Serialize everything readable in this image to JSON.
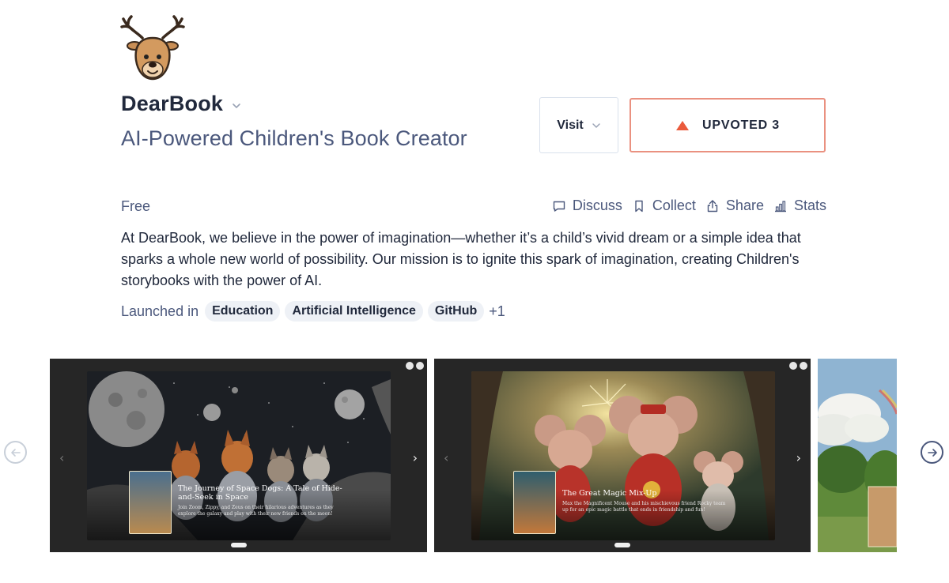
{
  "product": {
    "name": "DearBook",
    "tagline": "AI-Powered Children's Book Creator",
    "pricing": "Free",
    "description": "At DearBook, we believe in the power of imagination—whether it’s a child’s vivid dream or a simple idea that sparks a whole new world of possibility. Our mission is to ignite this spark of imagination, creating Children's storybooks with the power of AI."
  },
  "buttons": {
    "visit_label": "Visit",
    "upvote_label": "UPVOTED 3"
  },
  "actions": [
    {
      "label": "Discuss",
      "icon": "comment-icon"
    },
    {
      "label": "Collect",
      "icon": "bookmark-icon"
    },
    {
      "label": "Share",
      "icon": "share-icon"
    },
    {
      "label": "Stats",
      "icon": "bar-chart-icon"
    }
  ],
  "launched": {
    "label": "Launched in",
    "tags": [
      "Education",
      "Artificial Intelligence",
      "GitHub"
    ],
    "more": "+1"
  },
  "gallery": {
    "slides": [
      {
        "title": "The Journey of Space Dogs: A Tale of Hide-and-Seek in Space",
        "subtitle": "Join Zoom, Zippy, and Zeus on their hilarious adventures as they explore the galaxy and play with their new friends on the moon!"
      },
      {
        "title": "The Great Magic Mix-Up",
        "subtitle": "Max the Magnificent Mouse and his mischievous friend Rocky team up for an epic magic battle that ends in friendship and fun!"
      }
    ]
  },
  "colors": {
    "text_primary": "#21293c",
    "text_secondary": "#4b587c",
    "upvote_accent": "#ea5a3c",
    "upvote_border": "#ea9180",
    "tag_bg": "#eef1f6"
  }
}
